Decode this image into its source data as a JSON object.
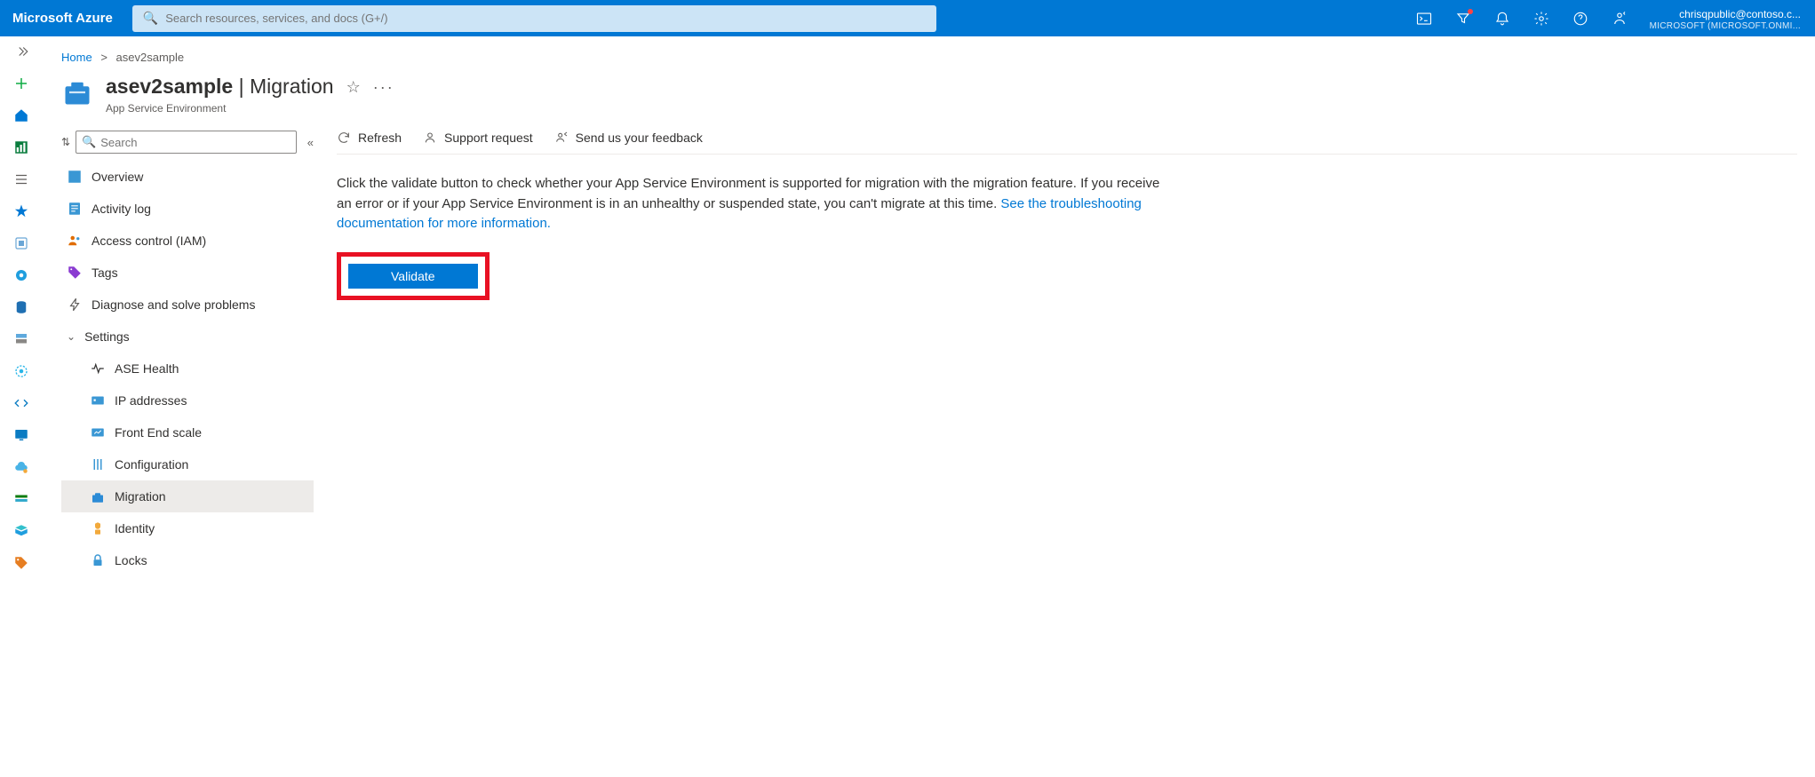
{
  "header": {
    "brand": "Microsoft Azure",
    "search_placeholder": "Search resources, services, and docs (G+/)",
    "account": {
      "email": "chrisqpublic@contoso.c...",
      "tenant": "MICROSOFT (MICROSOFT.ONMI..."
    }
  },
  "breadcrumb": {
    "home": "Home",
    "sep": ">",
    "current": "asev2sample"
  },
  "title": {
    "resource": "asev2sample",
    "page": "Migration",
    "sub": "App Service Environment"
  },
  "nav": {
    "search_placeholder": "Search",
    "items": [
      {
        "label": "Overview",
        "kind": "item"
      },
      {
        "label": "Activity log",
        "kind": "item"
      },
      {
        "label": "Access control (IAM)",
        "kind": "item"
      },
      {
        "label": "Tags",
        "kind": "item"
      },
      {
        "label": "Diagnose and solve problems",
        "kind": "item"
      },
      {
        "label": "Settings",
        "kind": "section"
      },
      {
        "label": "ASE Health",
        "kind": "sub"
      },
      {
        "label": "IP addresses",
        "kind": "sub"
      },
      {
        "label": "Front End scale",
        "kind": "sub"
      },
      {
        "label": "Configuration",
        "kind": "sub"
      },
      {
        "label": "Migration",
        "kind": "sub",
        "selected": true
      },
      {
        "label": "Identity",
        "kind": "sub"
      },
      {
        "label": "Locks",
        "kind": "sub"
      }
    ]
  },
  "toolbar": {
    "refresh": "Refresh",
    "support": "Support request",
    "feedback": "Send us your feedback"
  },
  "content": {
    "desc": "Click the validate button to check whether your App Service Environment is supported for migration with the migration feature. If you receive an error or if your App Service Environment is in an unhealthy or suspended state, you can't migrate at this time. ",
    "link": "See the troubleshooting documentation for more information.",
    "validate": "Validate"
  }
}
